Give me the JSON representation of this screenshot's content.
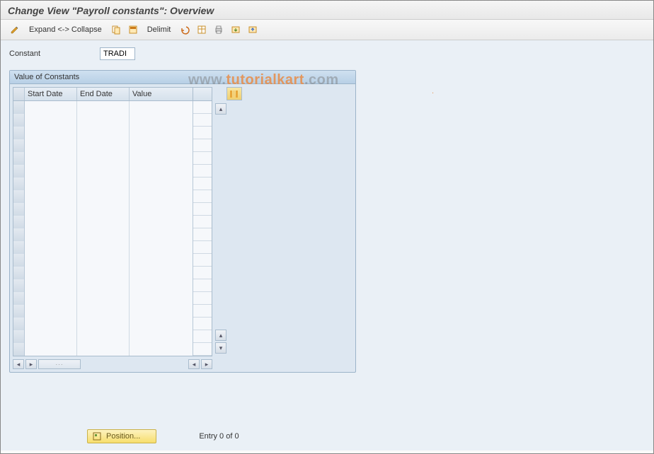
{
  "header": {
    "title": "Change View \"Payroll constants\": Overview"
  },
  "toolbar": {
    "expand_collapse_label": "Expand <-> Collapse",
    "delimit_label": "Delimit"
  },
  "fields": {
    "constant_label": "Constant",
    "constant_value": "TRADI"
  },
  "panel": {
    "title": "Value of Constants",
    "columns": {
      "start_date": "Start Date",
      "end_date": "End Date",
      "value": "Value"
    },
    "row_count": 20
  },
  "footer": {
    "position_label": "Position...",
    "entry_text": "Entry 0 of 0"
  },
  "watermark": {
    "prefix": "www.",
    "brand": "tutorialkart",
    "suffix": ".com"
  }
}
